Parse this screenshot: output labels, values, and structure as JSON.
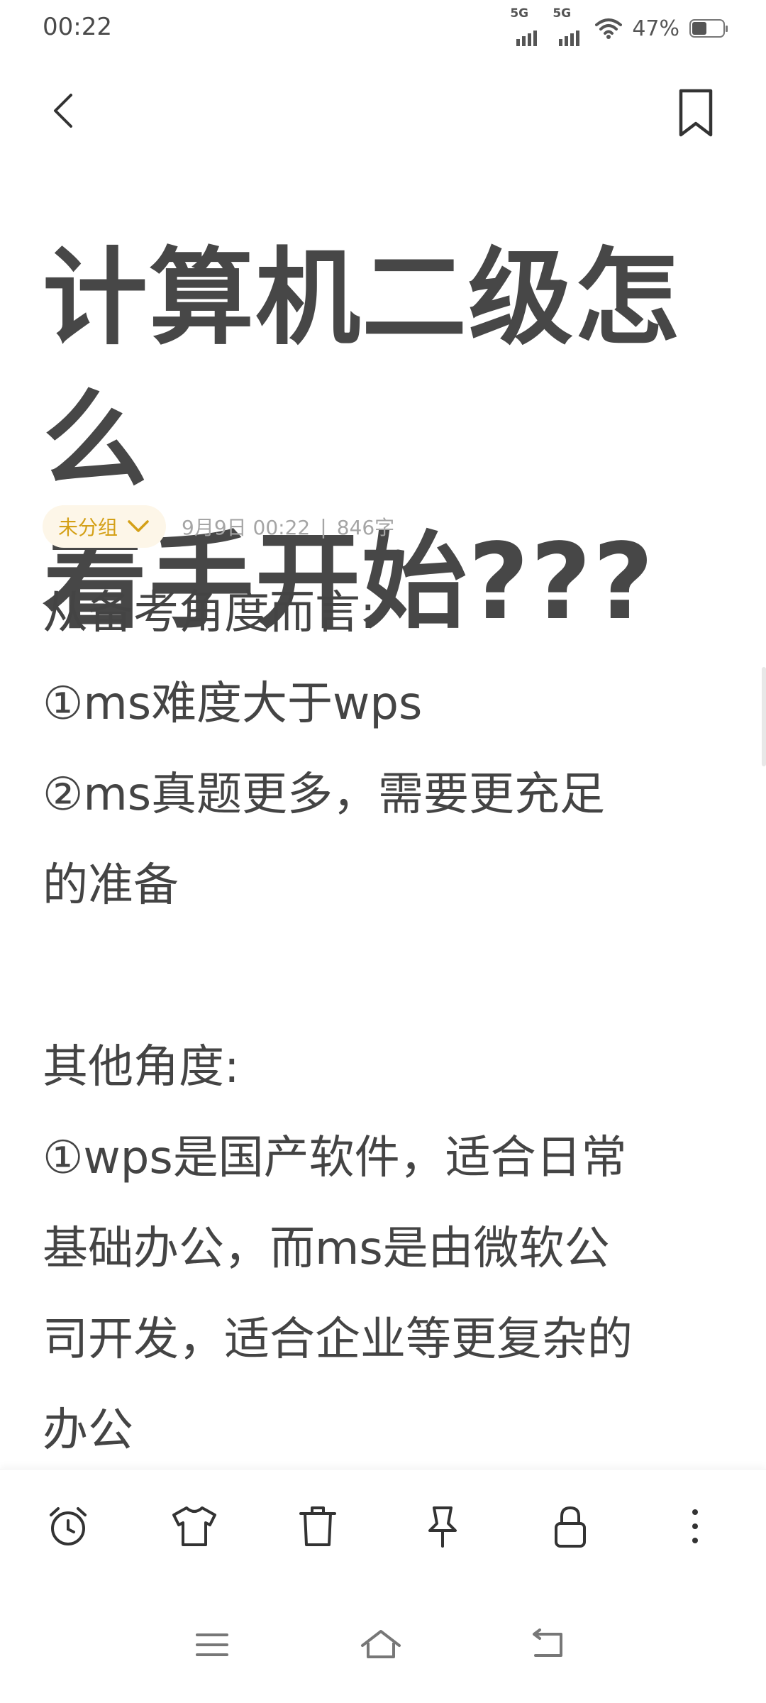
{
  "status_bar": {
    "time": "00:22",
    "signal1_label": "5G",
    "signal2_label": "5G",
    "battery_pct": "47%"
  },
  "note": {
    "title_line1": "计算机二级怎么",
    "title_line2": "着手开始???",
    "group_label": "未分组",
    "date": "9月9日 00:22",
    "separator": "|",
    "word_count": "846字",
    "lines": [
      "从备考角度而言:",
      "①ms难度大于wps",
      "②ms真题更多，需要更充足",
      "的准备",
      "",
      "其他角度:",
      "①wps是国产软件，适合日常",
      "基础办公，而ms是由微软公",
      "司开发，适合企业等更复杂的",
      "办公"
    ]
  },
  "colors": {
    "accent": "#d4a017",
    "chip_bg": "#fdf6e8",
    "text": "#444444",
    "meta": "#a5a5a5"
  },
  "toolbar": {
    "icons": [
      "alarm-clock-icon",
      "tshirt-icon",
      "trash-icon",
      "pin-icon",
      "lock-icon",
      "more-vertical-icon"
    ]
  },
  "navbar": {
    "icons": [
      "menu-icon",
      "home-icon",
      "back-icon"
    ]
  }
}
